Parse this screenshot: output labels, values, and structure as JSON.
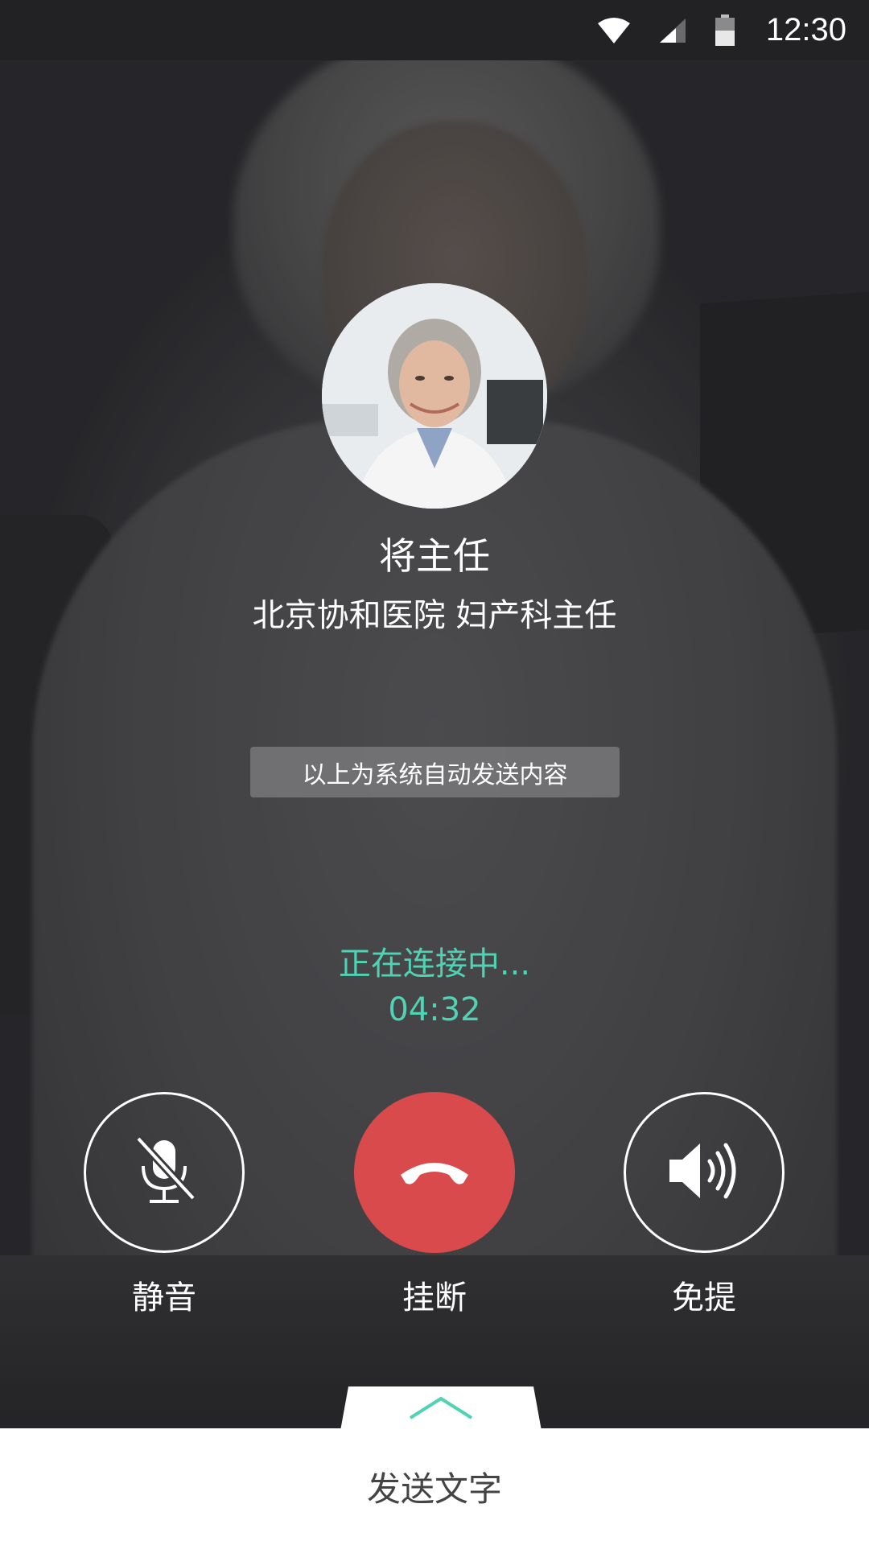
{
  "status_bar": {
    "time": "12:30",
    "icons": [
      "wifi-icon",
      "signal-icon",
      "battery-icon"
    ]
  },
  "caller": {
    "name": "将主任",
    "title": "北京协和医院 妇产科主任"
  },
  "system_notice": "以上为系统自动发送内容",
  "call": {
    "status": "正在连接中...",
    "timer": "04:32"
  },
  "controls": {
    "mute": {
      "label": "静音",
      "icon": "mic-off-icon"
    },
    "hangup": {
      "label": "挂断",
      "icon": "phone-hangup-icon"
    },
    "speaker": {
      "label": "免提",
      "icon": "speaker-icon"
    }
  },
  "bottom_panel": {
    "expand_icon": "chevron-up-icon",
    "label": "发送文字"
  },
  "colors": {
    "accent": "#4fd3b4",
    "hangup": "#d94a4c",
    "status_bar": "#222224"
  }
}
